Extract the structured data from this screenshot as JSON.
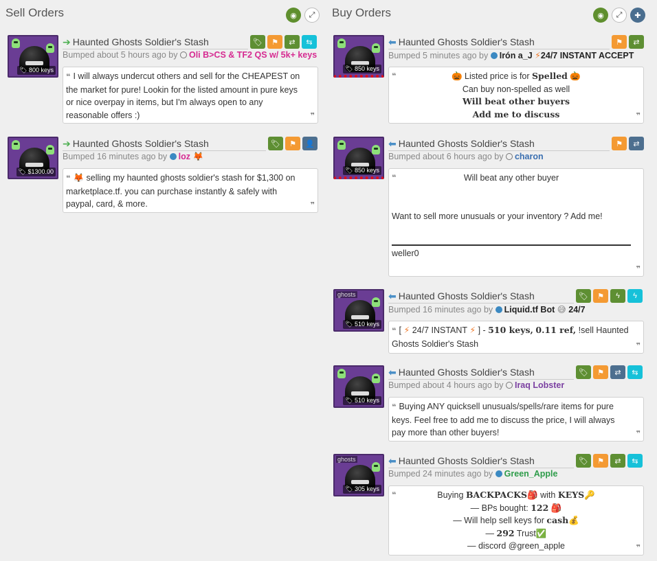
{
  "colors": {
    "user_pink": "#d62a91",
    "user_blue": "#3b6fb0",
    "user_purple": "#7a3fa1",
    "user_green": "#2e9c4a",
    "user_black": "#222222"
  },
  "sell": {
    "title": "Sell Orders",
    "listings": [
      {
        "item_name": "Haunted Ghosts Soldier's Stash",
        "price": "800 keys",
        "bumped": "Bumped about 5 hours ago by",
        "user": "Oli B>CS & TF2 QS w/ 5k+ keys",
        "details": "I will always undercut others and sell for the CHEAPEST on the market for pure! Lookin for the listed amount in pure keys or nice overpay in items, but I'm always open to any reasonable offers :)"
      },
      {
        "item_name": "Haunted Ghosts Soldier's Stash",
        "price": "$1300.00",
        "bumped": "Bumped 16 minutes ago by",
        "user": "loz",
        "user_emoji": "🦊",
        "details_emoji": "🦊",
        "details": "selling my haunted ghosts soldier's stash for $1,300 on marketplace.tf. you can purchase instantly & safely with paypal, card, & more."
      }
    ]
  },
  "buy": {
    "title": "Buy Orders",
    "listings": [
      {
        "item_name": "Haunted Ghosts Soldier's Stash",
        "price": "850 keys",
        "bumped": "Bumped 5 minutes ago by",
        "user": "Irón a_J",
        "user_suffix": "24/7 INSTANT ACCEPT",
        "lines": [
          "Listed price is for",
          "Spelled",
          "Can buy non-spelled as well",
          "Will beat other buyers",
          "Add me to discuss"
        ]
      },
      {
        "item_name": "Haunted Ghosts Soldier's Stash",
        "price": "850 keys",
        "bumped": "Bumped about 6 hours ago by",
        "user": "charon",
        "lines": [
          "Will beat any other buyer",
          "Want to sell more unusuals or your inventory ? Add me!",
          "weller0"
        ]
      },
      {
        "item_name": "Haunted Ghosts Soldier's Stash",
        "price": "510 keys",
        "label": "ghosts",
        "bumped": "Bumped 16 minutes ago by",
        "user": "Liquid.tf Bot",
        "user_suffix": "24/7",
        "details_a": "[",
        "details_b": "24/7 INSTANT",
        "details_c": "] -",
        "details_d": "510 keys,",
        "details_e": "0.11 ref,",
        "details_f": "!sell Haunted Ghosts Soldier's Stash"
      },
      {
        "item_name": "Haunted Ghosts Soldier's Stash",
        "price": "510 keys",
        "bumped": "Bumped about 4 hours ago by",
        "user": "Iraq Lobster",
        "details": "Buying ANY quicksell unusuals/spells/rare items for pure keys. Feel free to add me to discuss the price, I will always pay more than other buyers!"
      },
      {
        "item_name": "Haunted Ghosts Soldier's Stash",
        "price": "305 keys",
        "label": "ghosts",
        "bumped": "Bumped 24 minutes ago by",
        "user": "Green_Apple",
        "lines": [
          "Buying",
          "BACKPACKS",
          "with",
          "KEYS",
          "— BPs bought:",
          "122",
          "— Will help sell keys for",
          "cash",
          "—",
          "292",
          "Trust",
          "— discord @green_apple"
        ]
      }
    ]
  }
}
